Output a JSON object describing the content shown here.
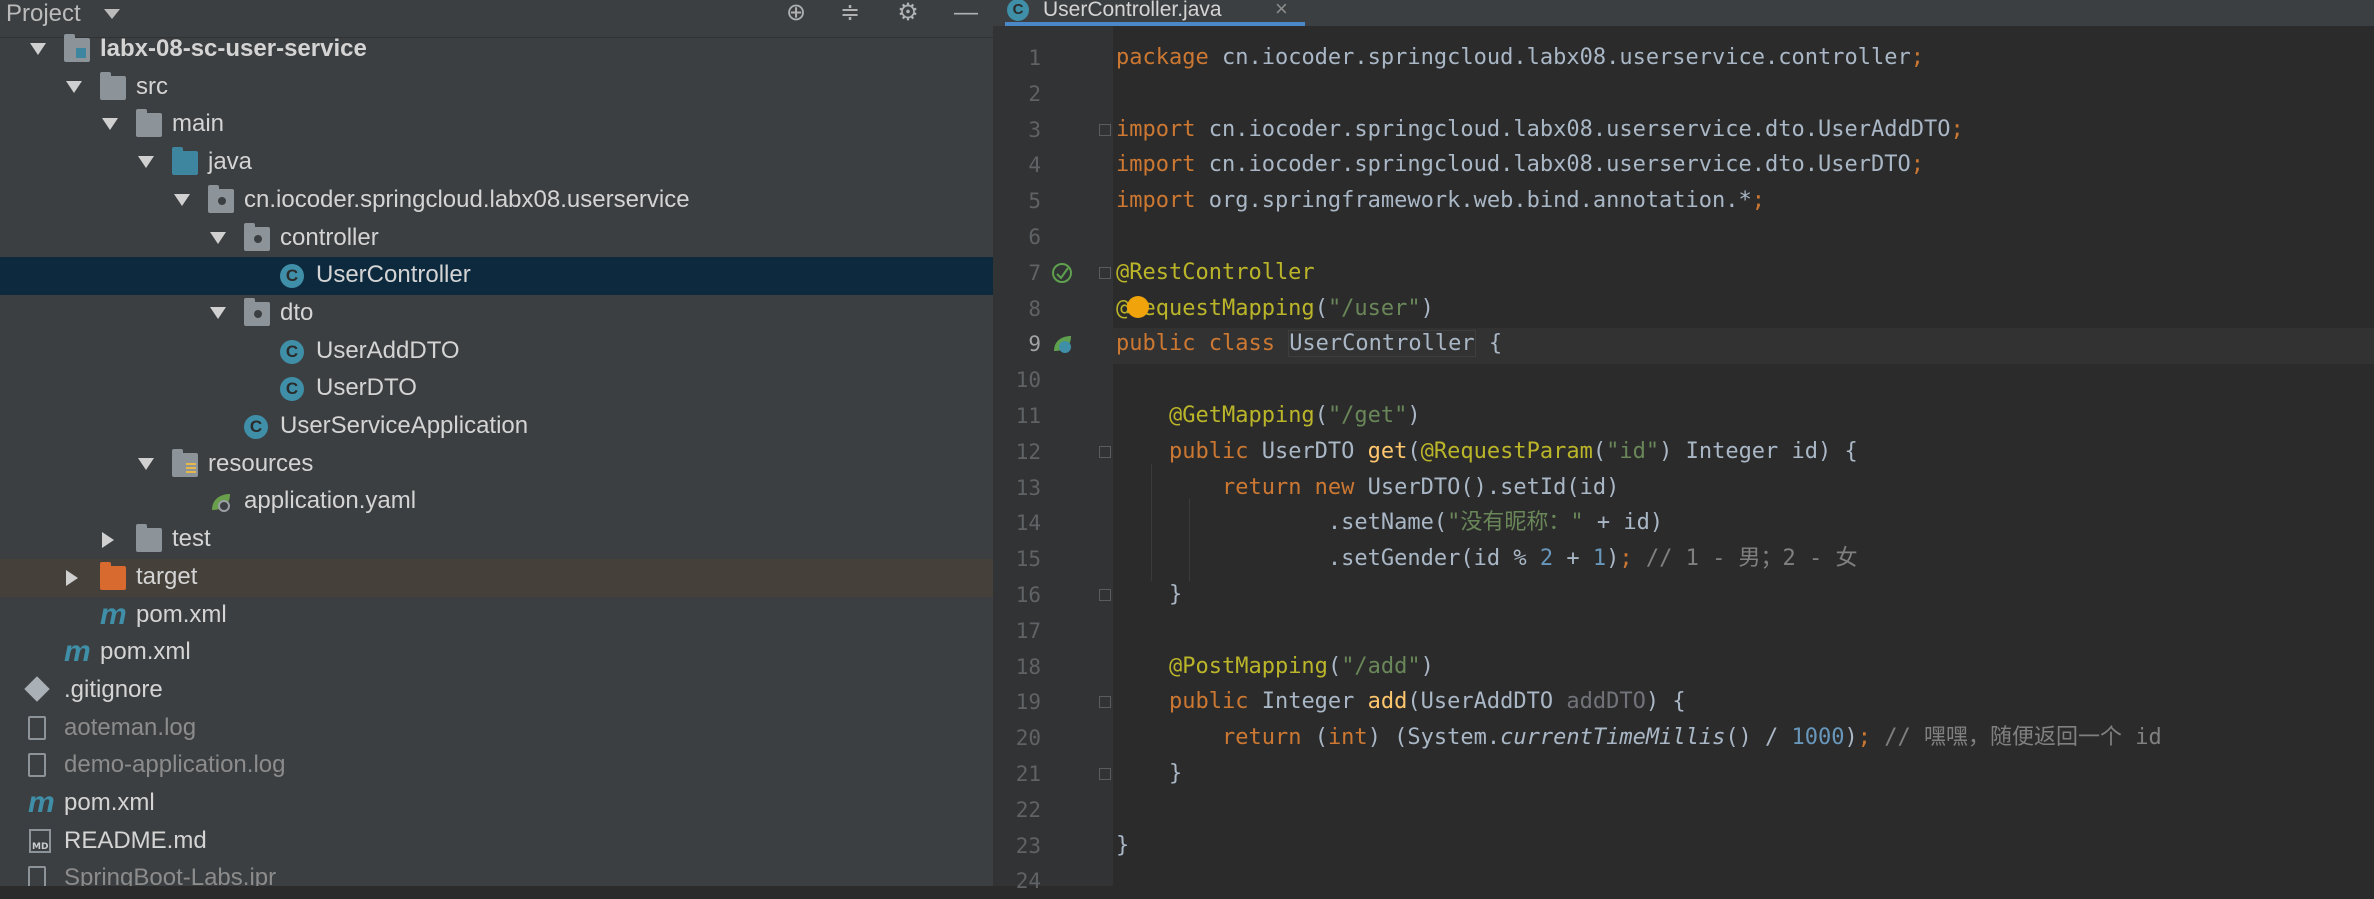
{
  "project_panel": {
    "title": "Project",
    "header_icons": [
      "locate-icon",
      "collapse-all-icon",
      "gear-icon",
      "minimize-icon"
    ],
    "tree": [
      {
        "label": "labx-08-sc-user-service",
        "indent": 0,
        "arrow": "down",
        "icon": "module-folder",
        "bold": true
      },
      {
        "label": "src",
        "indent": 1,
        "arrow": "down",
        "icon": "folder"
      },
      {
        "label": "main",
        "indent": 2,
        "arrow": "down",
        "icon": "folder"
      },
      {
        "label": "java",
        "indent": 3,
        "arrow": "down",
        "icon": "source-folder"
      },
      {
        "label": "cn.iocoder.springcloud.labx08.userservice",
        "indent": 4,
        "arrow": "down",
        "icon": "package"
      },
      {
        "label": "controller",
        "indent": 5,
        "arrow": "down",
        "icon": "package"
      },
      {
        "label": "UserController",
        "indent": 6,
        "arrow": "none",
        "icon": "class",
        "selected": true
      },
      {
        "label": "dto",
        "indent": 5,
        "arrow": "down",
        "icon": "package"
      },
      {
        "label": "UserAddDTO",
        "indent": 6,
        "arrow": "none",
        "icon": "class"
      },
      {
        "label": "UserDTO",
        "indent": 6,
        "arrow": "none",
        "icon": "class"
      },
      {
        "label": "UserServiceApplication",
        "indent": 5,
        "arrow": "none",
        "icon": "spring-class"
      },
      {
        "label": "resources",
        "indent": 3,
        "arrow": "down",
        "icon": "resources-folder"
      },
      {
        "label": "application.yaml",
        "indent": 4,
        "arrow": "none",
        "icon": "spring-config"
      },
      {
        "label": "test",
        "indent": 2,
        "arrow": "right",
        "icon": "folder"
      },
      {
        "label": "target",
        "indent": 1,
        "arrow": "right",
        "icon": "excluded-folder",
        "excluded": true
      },
      {
        "label": "pom.xml",
        "indent": 1,
        "arrow": "none",
        "icon": "maven"
      },
      {
        "label": "pom.xml",
        "indent": 0,
        "arrow": "none",
        "icon": "maven"
      },
      {
        "label": ".gitignore",
        "indent": -1,
        "arrow": "none",
        "icon": "git"
      },
      {
        "label": "aoteman.log",
        "indent": -1,
        "arrow": "none",
        "icon": "file",
        "dim": true
      },
      {
        "label": "demo-application.log",
        "indent": -1,
        "arrow": "none",
        "icon": "file",
        "dim": true
      },
      {
        "label": "pom.xml",
        "indent": -1,
        "arrow": "none",
        "icon": "maven"
      },
      {
        "label": "README.md",
        "indent": -1,
        "arrow": "none",
        "icon": "markdown"
      },
      {
        "label": "SpringBoot-Labs.ipr",
        "indent": -1,
        "arrow": "none",
        "icon": "file",
        "dim": true
      }
    ]
  },
  "editor": {
    "tab": {
      "label": "UserController.java",
      "close": "×"
    },
    "current_line": 9,
    "lines": [
      {
        "n": "1",
        "tokens": [
          [
            "kw",
            "package "
          ],
          [
            "plain",
            "cn.iocoder.springcloud.labx08.userservice.controller"
          ],
          [
            "kw",
            ";"
          ]
        ]
      },
      {
        "n": "2",
        "tokens": []
      },
      {
        "n": "3",
        "tokens": [
          [
            "kw",
            "import "
          ],
          [
            "plain",
            "cn.iocoder.springcloud.labx08.userservice.dto.UserAddDTO"
          ],
          [
            "kw",
            ";"
          ]
        ]
      },
      {
        "n": "4",
        "tokens": [
          [
            "kw",
            "import "
          ],
          [
            "plain",
            "cn.iocoder.springcloud.labx08.userservice.dto.UserDTO"
          ],
          [
            "kw",
            ";"
          ]
        ]
      },
      {
        "n": "5",
        "tokens": [
          [
            "kw",
            "import "
          ],
          [
            "plain",
            "org.springframework.web.bind.annotation.*"
          ],
          [
            "kw",
            ";"
          ]
        ]
      },
      {
        "n": "6",
        "tokens": []
      },
      {
        "n": "7",
        "tokens": [
          [
            "ann",
            "@RestController"
          ]
        ]
      },
      {
        "n": "8",
        "tokens": [
          [
            "ann",
            "@RequestMapping"
          ],
          [
            "plain",
            "("
          ],
          [
            "str",
            "\"/user\""
          ],
          [
            "plain",
            ")"
          ]
        ]
      },
      {
        "n": "9",
        "tokens": [
          [
            "kw",
            "public class "
          ],
          [
            "cls",
            "UserController"
          ],
          [
            "plain",
            " {"
          ]
        ]
      },
      {
        "n": "10",
        "tokens": []
      },
      {
        "n": "11",
        "tokens": [
          [
            "plain",
            "    "
          ],
          [
            "ann",
            "@GetMapping"
          ],
          [
            "plain",
            "("
          ],
          [
            "str",
            "\"/get\""
          ],
          [
            "plain",
            ")"
          ]
        ]
      },
      {
        "n": "12",
        "tokens": [
          [
            "plain",
            "    "
          ],
          [
            "kw",
            "public "
          ],
          [
            "plain",
            "UserDTO "
          ],
          [
            "fn",
            "get"
          ],
          [
            "plain",
            "("
          ],
          [
            "ann",
            "@RequestParam"
          ],
          [
            "plain",
            "("
          ],
          [
            "str",
            "\"id\""
          ],
          [
            "plain",
            ") Integer id) {"
          ]
        ]
      },
      {
        "n": "13",
        "tokens": [
          [
            "plain",
            "        "
          ],
          [
            "kw",
            "return new "
          ],
          [
            "plain",
            "UserDTO().setId(id)"
          ]
        ]
      },
      {
        "n": "14",
        "tokens": [
          [
            "plain",
            "                .setName("
          ],
          [
            "str",
            "\"没有昵称：\" "
          ],
          [
            "plain",
            "+ id)"
          ]
        ]
      },
      {
        "n": "15",
        "tokens": [
          [
            "plain",
            "                .setGender(id % "
          ],
          [
            "num",
            "2 "
          ],
          [
            "plain",
            "+ "
          ],
          [
            "num",
            "1"
          ],
          [
            "plain",
            ")"
          ],
          [
            "kw",
            "; "
          ],
          [
            "cmt",
            "// 1 - 男；2 - 女"
          ]
        ]
      },
      {
        "n": "16",
        "tokens": [
          [
            "plain",
            "    }"
          ]
        ]
      },
      {
        "n": "17",
        "tokens": []
      },
      {
        "n": "18",
        "tokens": [
          [
            "plain",
            "    "
          ],
          [
            "ann",
            "@PostMapping"
          ],
          [
            "plain",
            "("
          ],
          [
            "str",
            "\"/add\""
          ],
          [
            "plain",
            ")"
          ]
        ]
      },
      {
        "n": "19",
        "tokens": [
          [
            "plain",
            "    "
          ],
          [
            "kw",
            "public "
          ],
          [
            "plain",
            "Integer "
          ],
          [
            "fn",
            "add"
          ],
          [
            "plain",
            "(UserAddDTO "
          ],
          [
            "param",
            "addDTO"
          ],
          [
            "plain",
            ") {"
          ]
        ]
      },
      {
        "n": "20",
        "tokens": [
          [
            "plain",
            "        "
          ],
          [
            "kw",
            "return "
          ],
          [
            "plain",
            "("
          ],
          [
            "kw",
            "int"
          ],
          [
            "plain",
            ") (System."
          ],
          [
            "it",
            "currentTimeMillis"
          ],
          [
            "plain",
            "() / "
          ],
          [
            "num",
            "1000"
          ],
          [
            "plain",
            ")"
          ],
          [
            "kw",
            "; "
          ],
          [
            "cmt",
            "// 嘿嘿，随便返回一个 id"
          ]
        ]
      },
      {
        "n": "21",
        "tokens": [
          [
            "plain",
            "    }"
          ]
        ]
      },
      {
        "n": "22",
        "tokens": []
      },
      {
        "n": "23",
        "tokens": [
          [
            "plain",
            "}"
          ]
        ]
      },
      {
        "n": "24",
        "tokens": []
      }
    ]
  },
  "colors": {
    "panel_bg": "#3c3f41",
    "editor_bg": "#2b2b2b",
    "selection": "#0d293e",
    "keyword": "#cc7832",
    "annotation": "#bbb529",
    "string": "#6a8759",
    "number": "#6897bb",
    "comment": "#808080",
    "method": "#ffc66d"
  }
}
